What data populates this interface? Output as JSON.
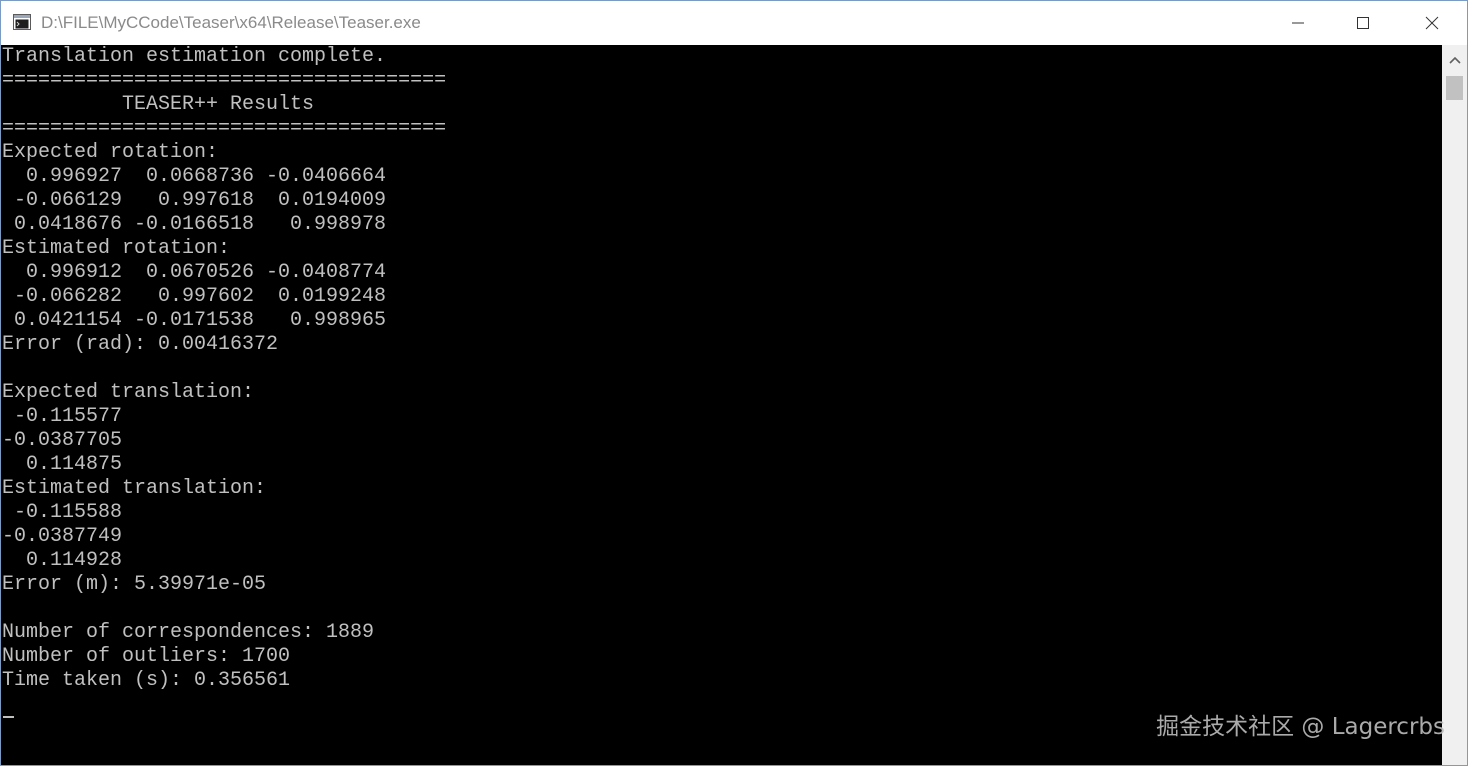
{
  "window": {
    "title": "D:\\FILE\\MyCCode\\Teaser\\x64\\Release\\Teaser.exe",
    "icon": "console-app-icon",
    "controls": [
      "minimize-icon",
      "maximize-icon",
      "close-icon"
    ]
  },
  "console": {
    "text": "Translation estimation complete.\n=====================================\n          TEASER++ Results\n=====================================\nExpected rotation:\n  0.996927  0.0668736 -0.0406664\n -0.066129   0.997618  0.0194009\n 0.0418676 -0.0166518   0.998978\nEstimated rotation:\n  0.996912  0.0670526 -0.0408774\n -0.066282   0.997602  0.0199248\n 0.0421154 -0.0171538   0.998965\nError (rad): 0.00416372\n\nExpected translation:\n -0.115577\n-0.0387705\n  0.114875\nEstimated translation:\n -0.115588\n-0.0387749\n  0.114928\nError (m): 5.39971e-05\n\nNumber of correspondences: 1889\nNumber of outliers: 1700\nTime taken (s): 0.356561"
  },
  "watermark": "掘金技术社区 @ Lagercrbs",
  "colors": {
    "console_bg": "#000000",
    "console_fg": "#c0c0c0",
    "titlebar_bg": "#ffffff",
    "title_fg": "#8a8a8a",
    "border": "#7a9cc4"
  }
}
